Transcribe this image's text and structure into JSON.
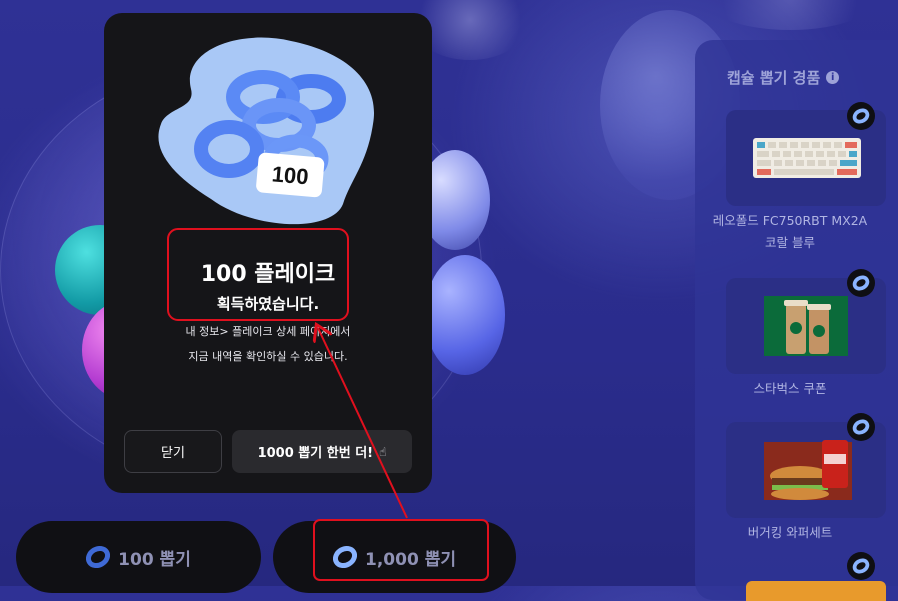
{
  "modal": {
    "badge_number": "100",
    "title": "100 플레이크",
    "subtitle": "획득하였습니다.",
    "desc_line1": "내 정보> 플레이크 상세 페이지에서",
    "desc_line2": "지금 내역을 확인하실 수 있습니다.",
    "close_label": "닫기",
    "again_label": "1000 뽑기 한번 더!"
  },
  "draw_buttons": [
    {
      "label": "100 뽑기",
      "icon": "donut-icon"
    },
    {
      "label": "1,000 뽑기",
      "icon": "donut-icon"
    }
  ],
  "prizes": {
    "title": "캡슐 뽑기 경품",
    "items": [
      {
        "label_line1": "레오폴드 FC750RBT MX2A",
        "label_line2": "코랄 블루",
        "image": "keyboard"
      },
      {
        "label_line1": "스타벅스 쿠폰",
        "label_line2": "",
        "image": "starbucks-drinks"
      },
      {
        "label_line1": "버거킹 와퍼세트",
        "label_line2": "",
        "image": "burger-set"
      }
    ]
  },
  "colors": {
    "background": "#2f3195",
    "modal": "#151518",
    "annotation": "#e0101e",
    "donut": "#6f9cff"
  }
}
